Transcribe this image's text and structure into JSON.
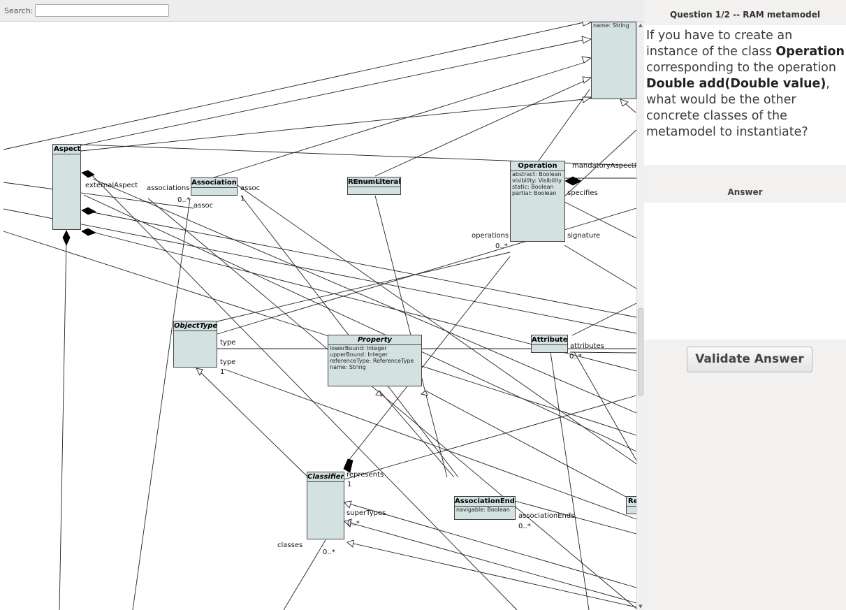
{
  "search": {
    "label": "Search:",
    "value": ""
  },
  "diagram": {
    "classes": {
      "top_unnamed": {
        "attrs": [
          "name: String"
        ]
      },
      "aspect": {
        "title": "Aspect"
      },
      "association": {
        "title": "Association"
      },
      "renumliteral": {
        "title": "REnumLiteral",
        "overlap": "RNamedElement"
      },
      "operation": {
        "title": "Operation",
        "attrs": [
          "abstract: Boolean",
          "visibility: Visibility",
          "static: Boolean",
          "partial: Boolean"
        ]
      },
      "objecttype": {
        "title": "ObjectType"
      },
      "property": {
        "title": "Property",
        "attrs": [
          "lowerBound: Integer",
          "upperBound: Integer",
          "referenceType: ReferenceType",
          "name: String"
        ]
      },
      "attribute": {
        "title": "Attribute"
      },
      "classifier": {
        "title": "Classifier"
      },
      "associationend": {
        "title": "AssociationEnd",
        "attrs": [
          "navigable: Boolean"
        ]
      },
      "re_partial": {
        "title": "Re"
      }
    },
    "labels": {
      "externalAspect": "externalAspect",
      "associations": "associations",
      "assoc1": "assoc",
      "assoc2": "assoc",
      "mult_0n_a": "0..*",
      "mult_1_a": "1",
      "mandatoryAspectP": "mandatoryAspectP",
      "specifies": "specifies",
      "signature": "signature",
      "operations": "operations",
      "mult_0n_b": "0..*",
      "type1": "type",
      "type2": "type",
      "mult_1_b": "1",
      "attributes": "attributes",
      "mult_0n_c": "0..*",
      "represents": "represents",
      "mult_1_c": "1",
      "superTypes": "superTypes",
      "mult_0n_d": "0..*",
      "associationEnds": "associationEnds",
      "mult_0n_e": "0..*",
      "classes": "classes",
      "mult_0n_f": "0..*"
    }
  },
  "question": {
    "header": "Question 1/2 -- RAM metamodel",
    "p1": "If you have to create an instance of the class ",
    "b1": "Operation",
    "p2": " corresponding to the operation ",
    "b2": "Double add(Double value)",
    "p3": ", what would be the other concrete classes of the metamodel to instantiate?"
  },
  "answer": {
    "header": "Answer",
    "value": ""
  },
  "validate_button": "Validate Answer"
}
